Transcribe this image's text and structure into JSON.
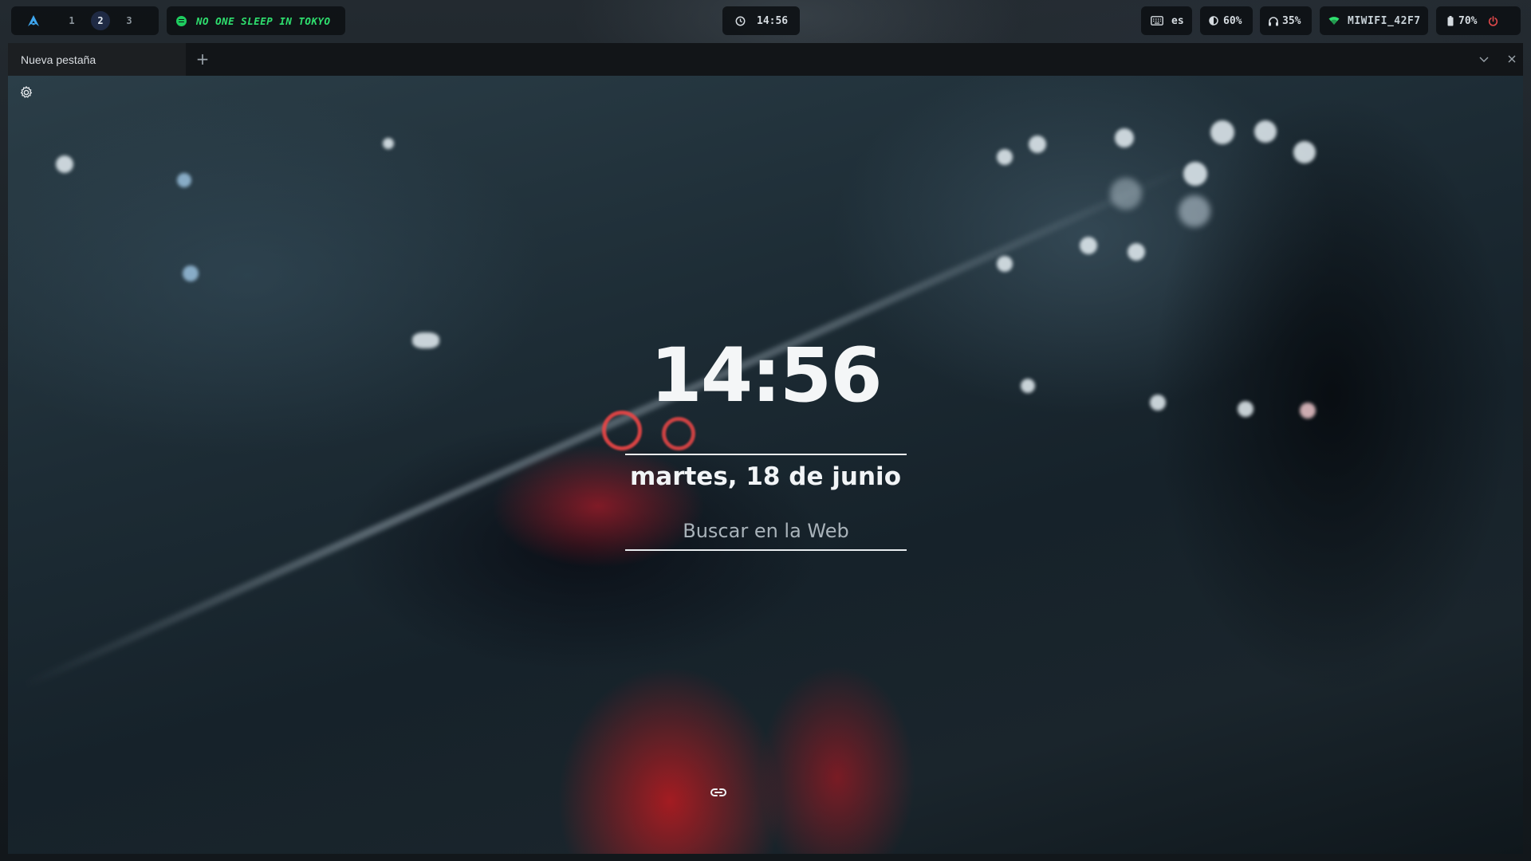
{
  "topbar": {
    "workspaces": [
      "1",
      "2",
      "3"
    ],
    "active_workspace": "2",
    "now_playing": "NO ONE SLEEP IN TOKYO",
    "clock": "14:56",
    "keyboard_layout": "es",
    "brightness": "60%",
    "volume": "35%",
    "wifi_ssid": "MIWIFI_42F7",
    "battery": "70%",
    "accent_color": "#2fe06f",
    "power_color": "#e0484a"
  },
  "browser": {
    "tab_title": "Nueva pestaña",
    "new_tab_symbol": "+"
  },
  "newtab_page": {
    "time": "14:56",
    "date": "martes, 18 de junio",
    "search_placeholder": "Buscar en la Web"
  }
}
